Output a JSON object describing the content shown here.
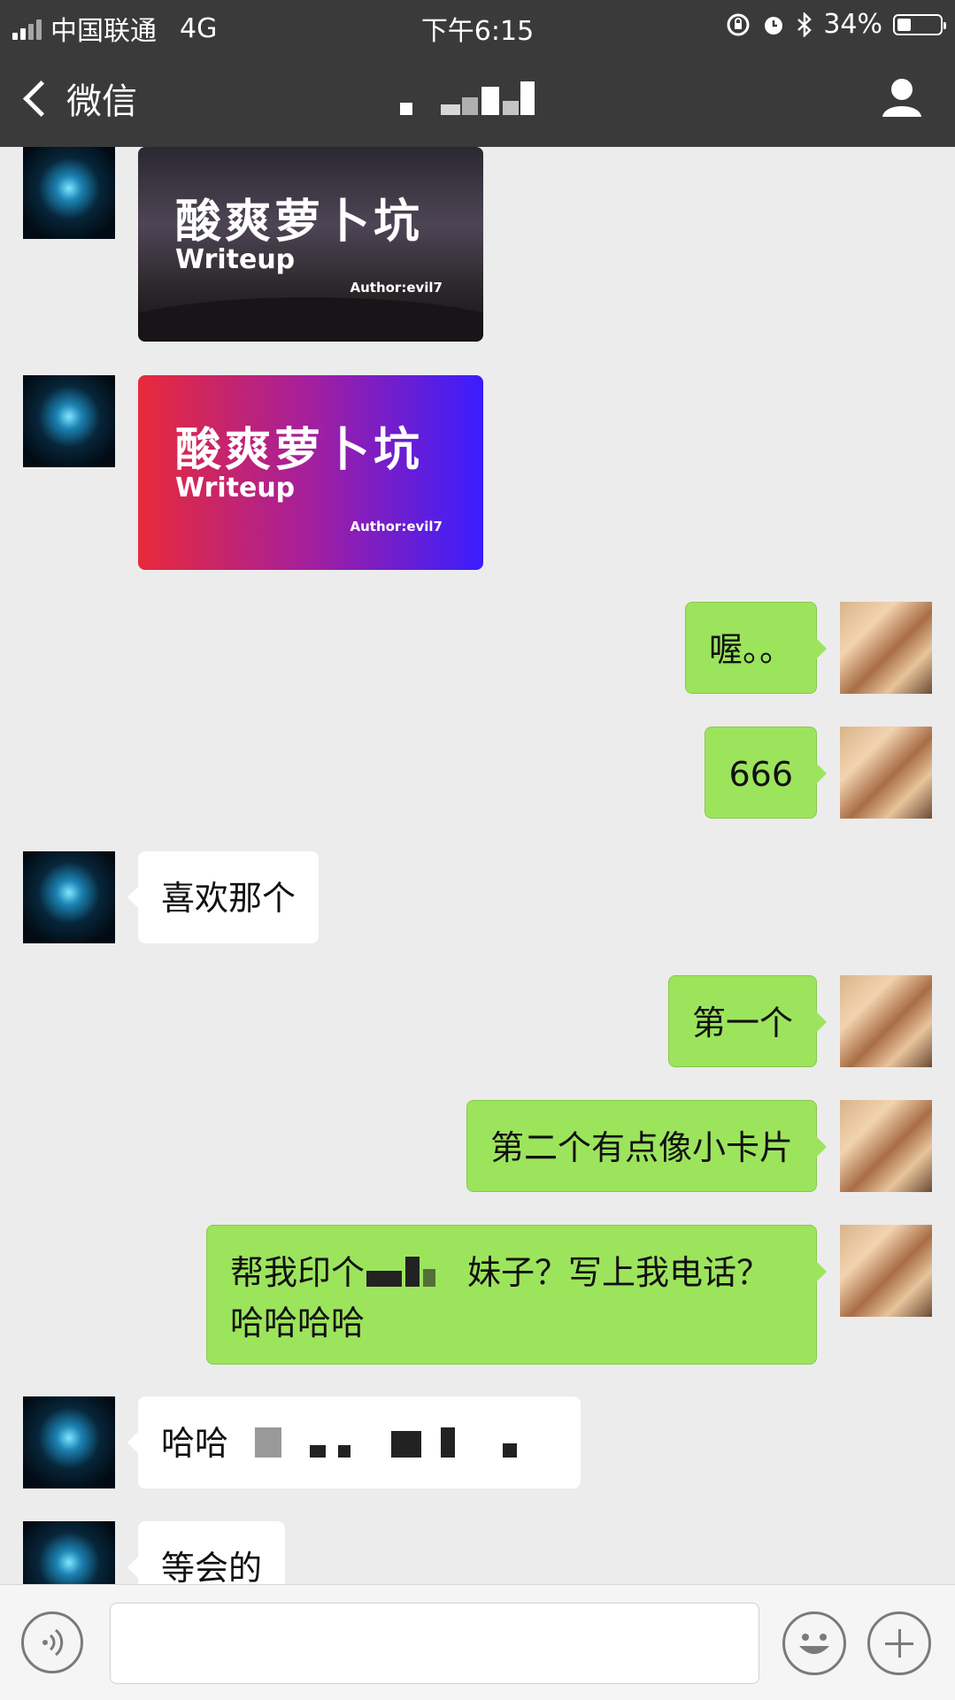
{
  "status_bar": {
    "carrier": "中国联通",
    "network": "4G",
    "time": "下午6:15",
    "battery": "34%",
    "battery_level": 0.34
  },
  "nav": {
    "back_label": "微信",
    "contact_icon": "user-icon"
  },
  "messages": [
    {
      "side": "in",
      "type": "image",
      "title": "酸爽萝卜坑",
      "subtitle": "Writeup",
      "author": "Author:evil7",
      "style": "dark"
    },
    {
      "side": "in",
      "type": "image",
      "title": "酸爽萝卜坑",
      "subtitle": "Writeup",
      "author": "Author:evil7",
      "style": "gradient"
    },
    {
      "side": "out",
      "type": "text",
      "text": "喔。。"
    },
    {
      "side": "out",
      "type": "text",
      "text": "666"
    },
    {
      "side": "in",
      "type": "text",
      "text": "喜欢那个"
    },
    {
      "side": "out",
      "type": "text",
      "text": "第一个"
    },
    {
      "side": "out",
      "type": "text",
      "text": "第二个有点像小卡片"
    },
    {
      "side": "out",
      "type": "text",
      "text_part1": "帮我印个",
      "text_part2": "妹子？写上我电话？哈哈哈哈"
    },
    {
      "side": "in",
      "type": "text",
      "text": "哈哈"
    },
    {
      "side": "in",
      "type": "text",
      "text": "等会的"
    }
  ],
  "input": {
    "voice_icon": "voice-icon",
    "emoji_icon": "emoji-icon",
    "plus_icon": "plus-icon"
  },
  "colors": {
    "outgoing_bubble": "#9de45d",
    "incoming_bubble": "#ffffff",
    "chat_background": "#ececec",
    "header": "#3a3a3a"
  }
}
